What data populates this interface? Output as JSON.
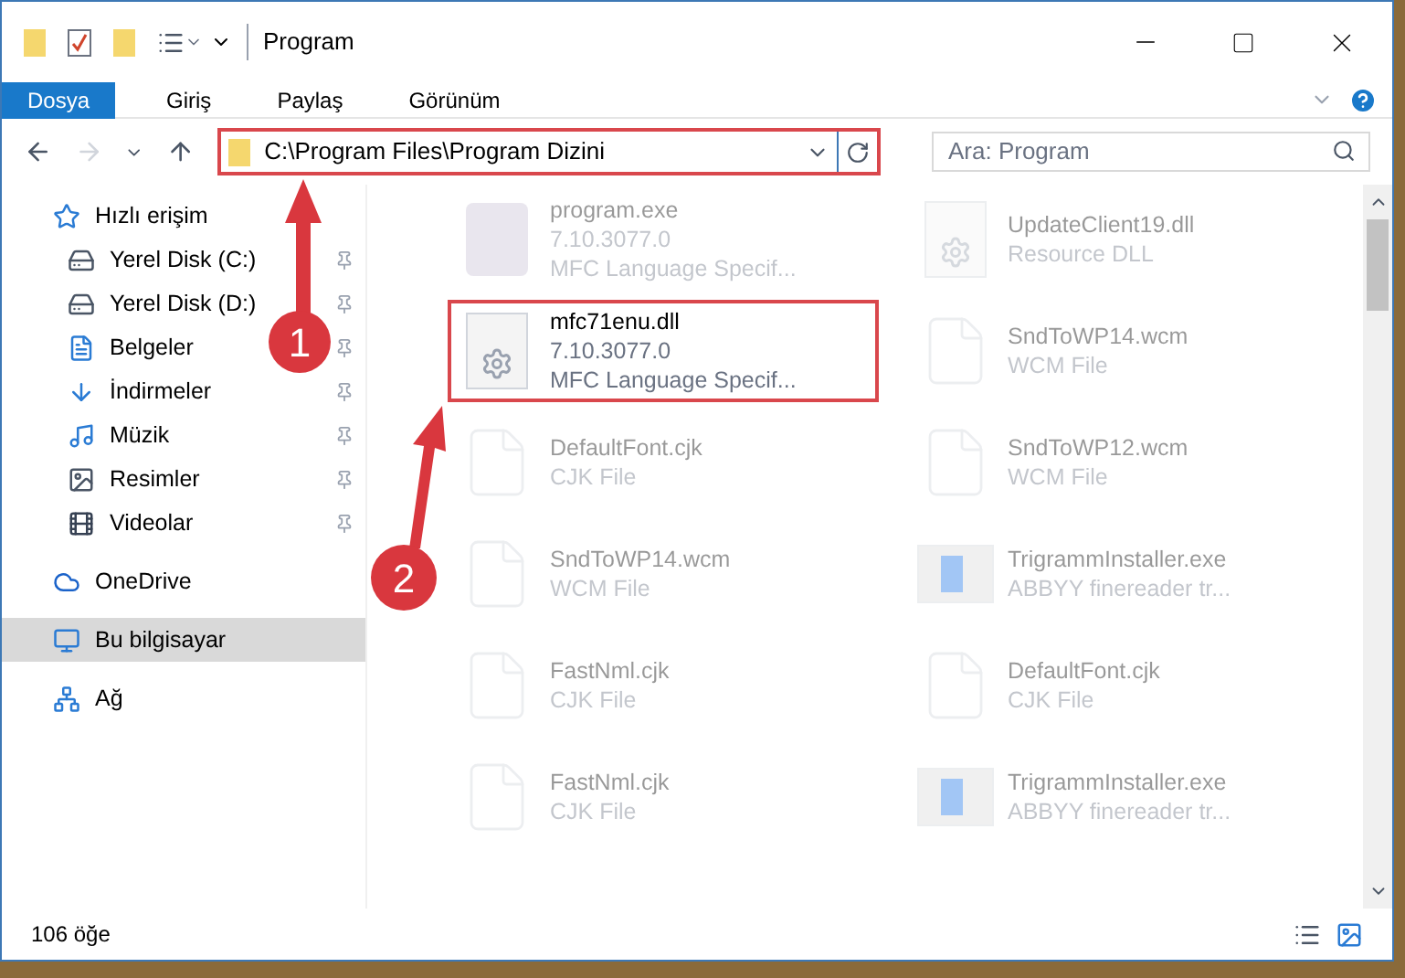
{
  "window": {
    "title": "Program"
  },
  "ribbon_tabs": [
    {
      "label": "Dosya",
      "selected": true
    },
    {
      "label": "Giriş",
      "selected": false
    },
    {
      "label": "Paylaş",
      "selected": false
    },
    {
      "label": "Görünüm",
      "selected": false
    }
  ],
  "address": {
    "value": "C:\\Program Files\\Program Dizini"
  },
  "search": {
    "placeholder": "Ara: Program"
  },
  "sidebar": {
    "items": [
      {
        "label": "Hızlı erişim",
        "kind": "star",
        "selected": false,
        "children": [
          {
            "label": "Yerel Disk (C:)",
            "kind": "drive",
            "selected": false
          },
          {
            "label": "Yerel Disk (D:)",
            "kind": "drive",
            "selected": false
          },
          {
            "label": "Belgeler",
            "kind": "doc",
            "selected": false
          },
          {
            "label": "İndirmeler",
            "kind": "download",
            "selected": false
          },
          {
            "label": "Müzik",
            "kind": "music",
            "selected": false
          },
          {
            "label": "Resimler",
            "kind": "picture",
            "selected": false
          },
          {
            "label": "Videolar",
            "kind": "video",
            "selected": false
          }
        ]
      },
      {
        "label": "OneDrive",
        "kind": "cloud",
        "selected": false
      },
      {
        "label": "Bu bilgisayar",
        "kind": "pc",
        "selected": true
      },
      {
        "label": "Ağ",
        "kind": "network",
        "selected": false
      }
    ]
  },
  "files": [
    {
      "name": "program.exe",
      "details": [
        "7.10.3077.0",
        "MFC Language Specif..."
      ],
      "kind": "exe",
      "highlighted": false
    },
    {
      "name": "UpdateClient19.dll",
      "details": [
        "Resource DLL"
      ],
      "kind": "dll",
      "highlighted": false
    },
    {
      "name": "mfc71enu.dll",
      "details": [
        "7.10.3077.0",
        "MFC Language Specif..."
      ],
      "kind": "dll",
      "highlighted": true
    },
    {
      "name": "SndToWP14.wcm",
      "details": [
        "WCM File"
      ],
      "kind": "file",
      "highlighted": false
    },
    {
      "name": "DefaultFont.cjk",
      "details": [
        "CJK File"
      ],
      "kind": "file",
      "highlighted": false
    },
    {
      "name": "SndToWP12.wcm",
      "details": [
        "WCM File"
      ],
      "kind": "file",
      "highlighted": false
    },
    {
      "name": "SndToWP14.wcm",
      "details": [
        "WCM File"
      ],
      "kind": "file",
      "highlighted": false
    },
    {
      "name": "TrigrammInstaller.exe",
      "details": [
        "ABBYY finereader tr..."
      ],
      "kind": "installer",
      "highlighted": false
    },
    {
      "name": "FastNml.cjk",
      "details": [
        "CJK File"
      ],
      "kind": "file",
      "highlighted": false
    },
    {
      "name": "DefaultFont.cjk",
      "details": [
        "CJK File"
      ],
      "kind": "file",
      "highlighted": false
    },
    {
      "name": "FastNml.cjk",
      "details": [
        "CJK File"
      ],
      "kind": "file",
      "highlighted": false
    },
    {
      "name": "TrigrammInstaller.exe",
      "details": [
        "ABBYY finereader tr..."
      ],
      "kind": "installer",
      "highlighted": false
    }
  ],
  "annotations": [
    {
      "number": "1"
    },
    {
      "number": "2"
    }
  ],
  "status_bar": {
    "count": "106 öğe"
  }
}
